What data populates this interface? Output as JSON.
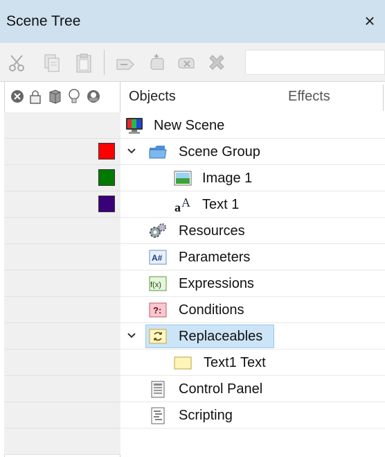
{
  "window": {
    "title": "Scene Tree",
    "close_glyph": "×"
  },
  "toolbar": {
    "buttons": [
      {
        "icon": "cut-icon"
      },
      {
        "icon": "copy-icon"
      },
      {
        "icon": "paste-icon"
      },
      {
        "icon": "tag-icon"
      },
      {
        "icon": "hand-add-icon"
      },
      {
        "icon": "hand-remove-icon"
      },
      {
        "icon": "delete-x-icon"
      }
    ],
    "search_value": ""
  },
  "columns": {
    "status_icons": [
      "disable-icon",
      "lock-icon",
      "cube-icon",
      "bulb-icon",
      "camera-icon"
    ],
    "objects_label": "Objects",
    "effects_label": "Effects"
  },
  "colors": {
    "scene_group": "#ff0000",
    "image_1": "#007a00",
    "text_1": "#3a007a",
    "selection": "#cce4f7"
  },
  "tree": {
    "new_scene": "New Scene",
    "scene_group": "Scene Group",
    "image_1": "Image 1",
    "text_1": "Text 1",
    "resources": "Resources",
    "parameters": "Parameters",
    "expressions": "Expressions",
    "conditions": "Conditions",
    "replaceables": "Replaceables",
    "text1_text": "Text1 Text",
    "control_panel": "Control Panel",
    "scripting": "Scripting"
  }
}
